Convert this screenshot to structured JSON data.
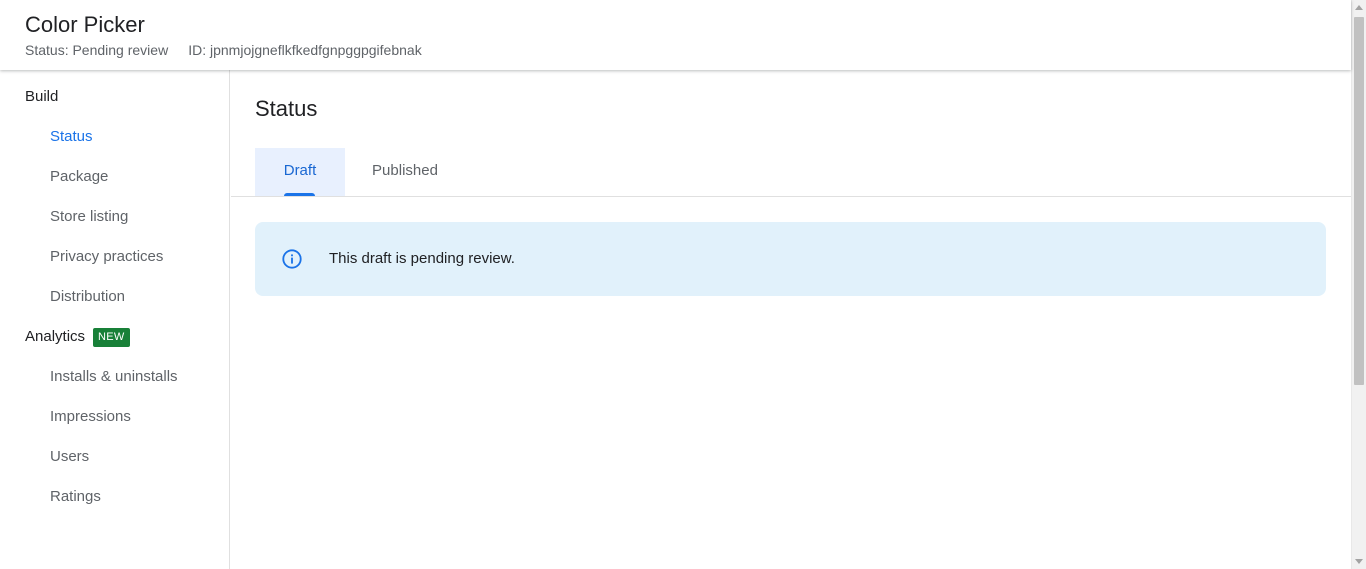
{
  "header": {
    "title": "Color Picker",
    "status": "Status: Pending review",
    "id": "ID: jpnmjojgneflkfkedfgnpggpgifebnak"
  },
  "sidebar": {
    "build_label": "Build",
    "build_items": [
      {
        "label": "Status",
        "active": true
      },
      {
        "label": "Package"
      },
      {
        "label": "Store listing"
      },
      {
        "label": "Privacy practices"
      },
      {
        "label": "Distribution"
      }
    ],
    "analytics_label": "Analytics",
    "analytics_badge": "NEW",
    "analytics_items": [
      {
        "label": "Installs & uninstalls"
      },
      {
        "label": "Impressions"
      },
      {
        "label": "Users"
      },
      {
        "label": "Ratings"
      }
    ]
  },
  "main": {
    "page_title": "Status",
    "tabs": [
      {
        "label": "Draft",
        "selected": true
      },
      {
        "label": "Published"
      }
    ],
    "banner": {
      "text": "This draft is pending review.",
      "icon": "info-icon"
    }
  },
  "colors": {
    "accent": "#1a73e8",
    "tab_selected_bg": "#e8f0fe",
    "banner_bg": "#e1f1fb",
    "badge_bg": "#188038"
  }
}
